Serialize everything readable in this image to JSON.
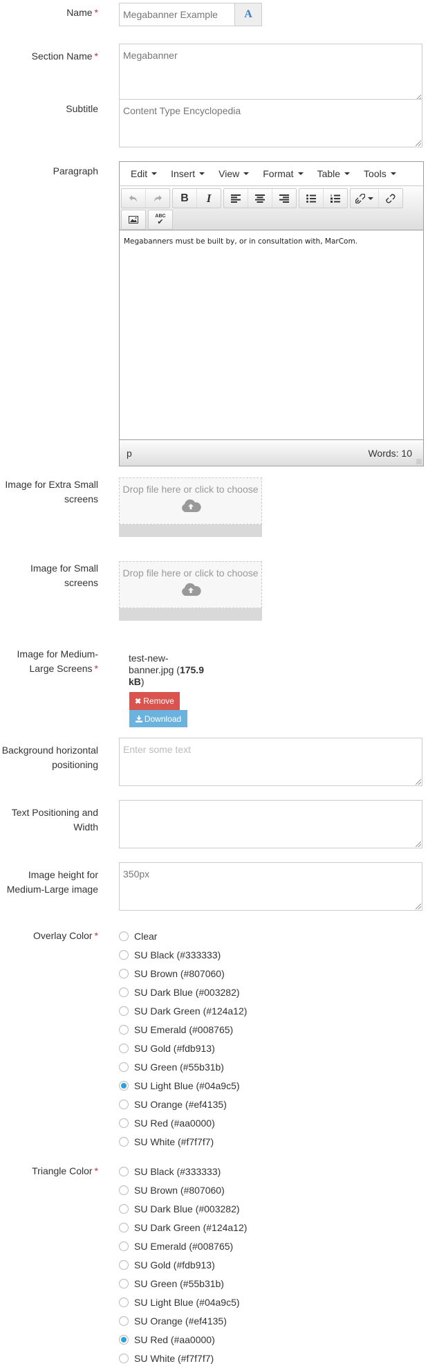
{
  "form": {
    "name": {
      "label": "Name",
      "required_mark": "*",
      "value": "Megabanner Example",
      "button_icon": "A"
    },
    "section_name": {
      "label": "Section Name",
      "required_mark": "*",
      "value": "Megabanner"
    },
    "subtitle": {
      "label": "Subtitle",
      "value": "Content Type Encyclopedia"
    },
    "paragraph": {
      "label": "Paragraph",
      "menus": [
        "Edit",
        "Insert",
        "View",
        "Format",
        "Table",
        "Tools"
      ],
      "toolbar": {
        "undo": "undo-icon",
        "redo": "redo-icon",
        "bold": "B",
        "italic": "I",
        "spellcheck": "ABC"
      },
      "content": "Megabanners must be built by, or in consultation with, MarCom.",
      "status_path": "p",
      "word_count": "Words: 10"
    },
    "image_xs": {
      "label_line1": "Image for Extra Small",
      "label_line2": "screens",
      "drop_text": "Drop file here or click to choose"
    },
    "image_sm": {
      "label_line1": "Image for Small",
      "label_line2": "screens",
      "drop_text": "Drop file here or click to choose"
    },
    "image_ml": {
      "label_line1": "Image for Medium-",
      "label_line2": "Large Screens",
      "required_mark": "*",
      "file_line1": "test-new-",
      "file_line2": "banner.jpg (",
      "file_size_a": "175.9",
      "file_size_b": "kB",
      "file_close": ")",
      "remove_label": "Remove",
      "download_label": "Download"
    },
    "bg_horizontal": {
      "label_line1": "Background horizontal",
      "label_line2": "positioning",
      "placeholder": "Enter some text"
    },
    "text_positioning": {
      "label_line1": "Text Positioning and",
      "label_line2": "Width",
      "value": ""
    },
    "image_height": {
      "label_line1": "Image height for",
      "label_line2": "Medium-Large image",
      "value": "350px"
    },
    "overlay_color": {
      "label": "Overlay Color",
      "required_mark": "*",
      "selected": "SU Light Blue (#04a9c5)",
      "options": [
        "Clear",
        "SU Black (#333333)",
        "SU Brown (#807060)",
        "SU Dark Blue (#003282)",
        "SU Dark Green (#124a12)",
        "SU Emerald (#008765)",
        "SU Gold (#fdb913)",
        "SU Green (#55b31b)",
        "SU Light Blue (#04a9c5)",
        "SU Orange (#ef4135)",
        "SU Red (#aa0000)",
        "SU White (#f7f7f7)"
      ]
    },
    "triangle_color": {
      "label": "Triangle Color",
      "required_mark": "*",
      "selected": "SU Red (#aa0000)",
      "options": [
        "SU Black (#333333)",
        "SU Brown (#807060)",
        "SU Dark Blue (#003282)",
        "SU Dark Green (#124a12)",
        "SU Emerald (#008765)",
        "SU Gold (#fdb913)",
        "SU Green (#55b31b)",
        "SU Light Blue (#04a9c5)",
        "SU Orange (#ef4135)",
        "SU Red (#aa0000)",
        "SU White (#f7f7f7)"
      ]
    }
  },
  "colors": {
    "required": "#c9302c",
    "remove_button": "#d9534f",
    "download_button": "#6cb2de",
    "radio_selected": "#2d9fd9"
  }
}
